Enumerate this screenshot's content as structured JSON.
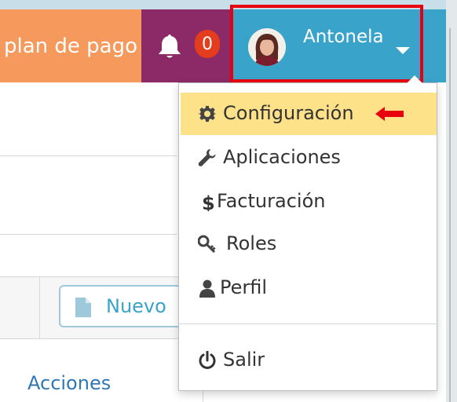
{
  "navbar": {
    "plan_label": "plan de pago",
    "notifications_count": "0",
    "user_name": "Antonela"
  },
  "dropdown": {
    "items": [
      {
        "label": "Configuración",
        "icon": "gear-icon",
        "active": true
      },
      {
        "label": "Aplicaciones",
        "icon": "wrench-icon"
      },
      {
        "label": "Facturación",
        "icon": "dollar-icon"
      },
      {
        "label": "Roles",
        "icon": "key-icon"
      },
      {
        "label": "Perfil",
        "icon": "user-icon"
      },
      {
        "label": "Salir",
        "icon": "power-icon"
      }
    ]
  },
  "toolbar": {
    "new_label": "Nuevo"
  },
  "table": {
    "actions_header": "Acciones"
  },
  "colors": {
    "plan": "#f59a5c",
    "notifications": "#8b2a66",
    "user_bar": "#3aa3c9",
    "badge": "#e33d1d",
    "highlight": "#e8000f",
    "active_item": "#fde28a"
  }
}
